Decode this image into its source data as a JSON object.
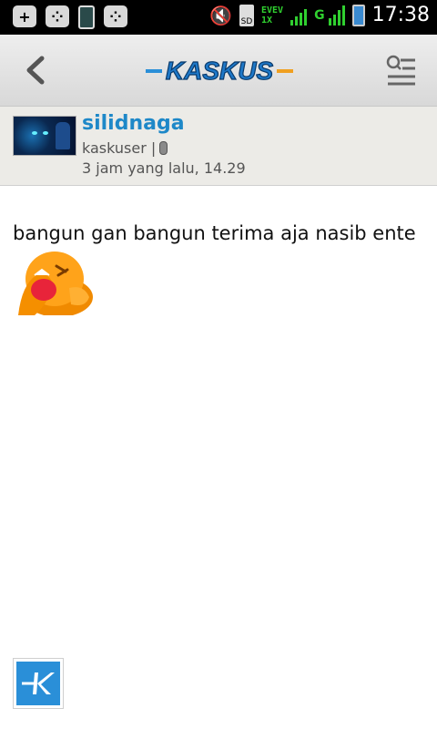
{
  "status_bar": {
    "time": "17:38",
    "network_top": "EVEV",
    "network_bottom": "1X",
    "g_label": "G",
    "sd_label": "SD"
  },
  "app_bar": {
    "logo_text": "KASKUS"
  },
  "post": {
    "username": "silidnaga",
    "user_title": "kaskuser |",
    "time": "3 jam yang lalu, 14.29",
    "body": "bangun gan bangun terima aja nasib ente"
  },
  "colors": {
    "accent": "#1e88c8",
    "status_green": "#30d030",
    "fab_blue": "#2a8fd8",
    "logo_orange": "#f0a020"
  },
  "icons": {
    "back": "chevron-left-icon",
    "menu": "search-list-icon",
    "emoticon": "laughing-emoticon"
  }
}
